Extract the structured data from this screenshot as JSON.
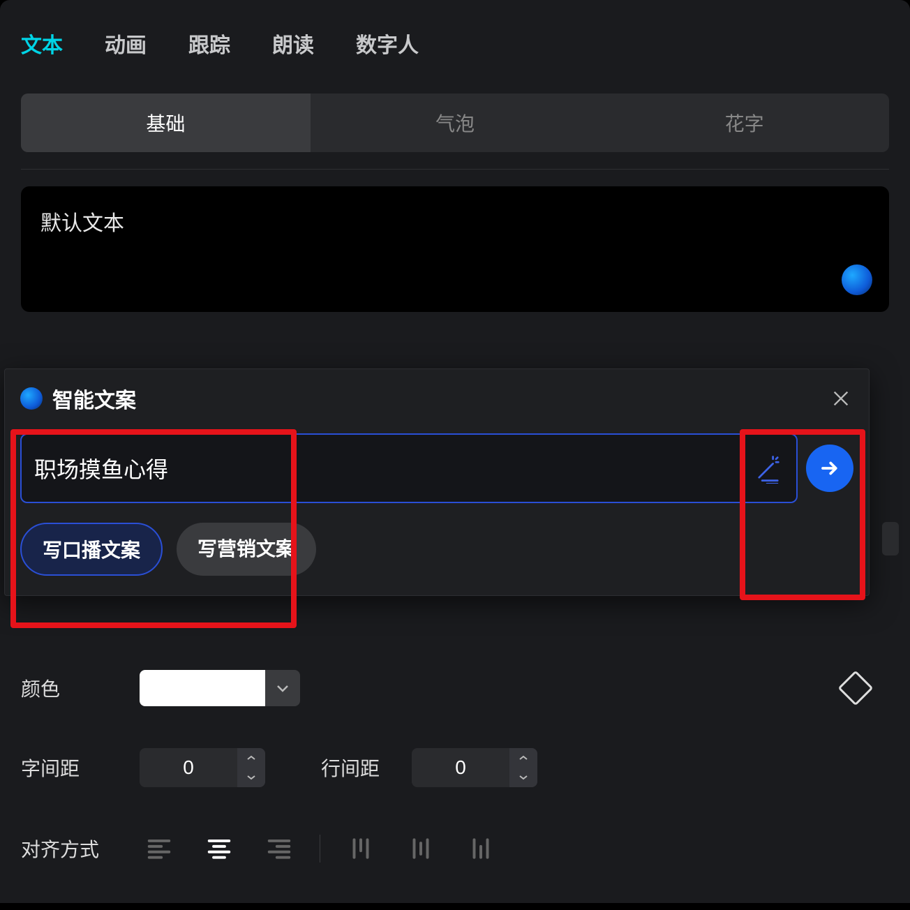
{
  "topTabs": {
    "items": [
      "文本",
      "动画",
      "跟踪",
      "朗读",
      "数字人"
    ],
    "activeIndex": 0
  },
  "subTabs": {
    "items": [
      "基础",
      "气泡",
      "花字"
    ],
    "activeIndex": 0
  },
  "textBox": {
    "value": "默认文本"
  },
  "smartCopy": {
    "title": "智能文案",
    "input_value": "职场摸鱼心得",
    "chips": [
      "写口播文案",
      "写营销文案"
    ],
    "activeChip": 0
  },
  "controls": {
    "color_label": "颜色",
    "color_value": "#FFFFFF",
    "letter_spacing_label": "字间距",
    "letter_spacing_value": "0",
    "line_spacing_label": "行间距",
    "line_spacing_value": "0",
    "align_label": "对齐方式"
  }
}
